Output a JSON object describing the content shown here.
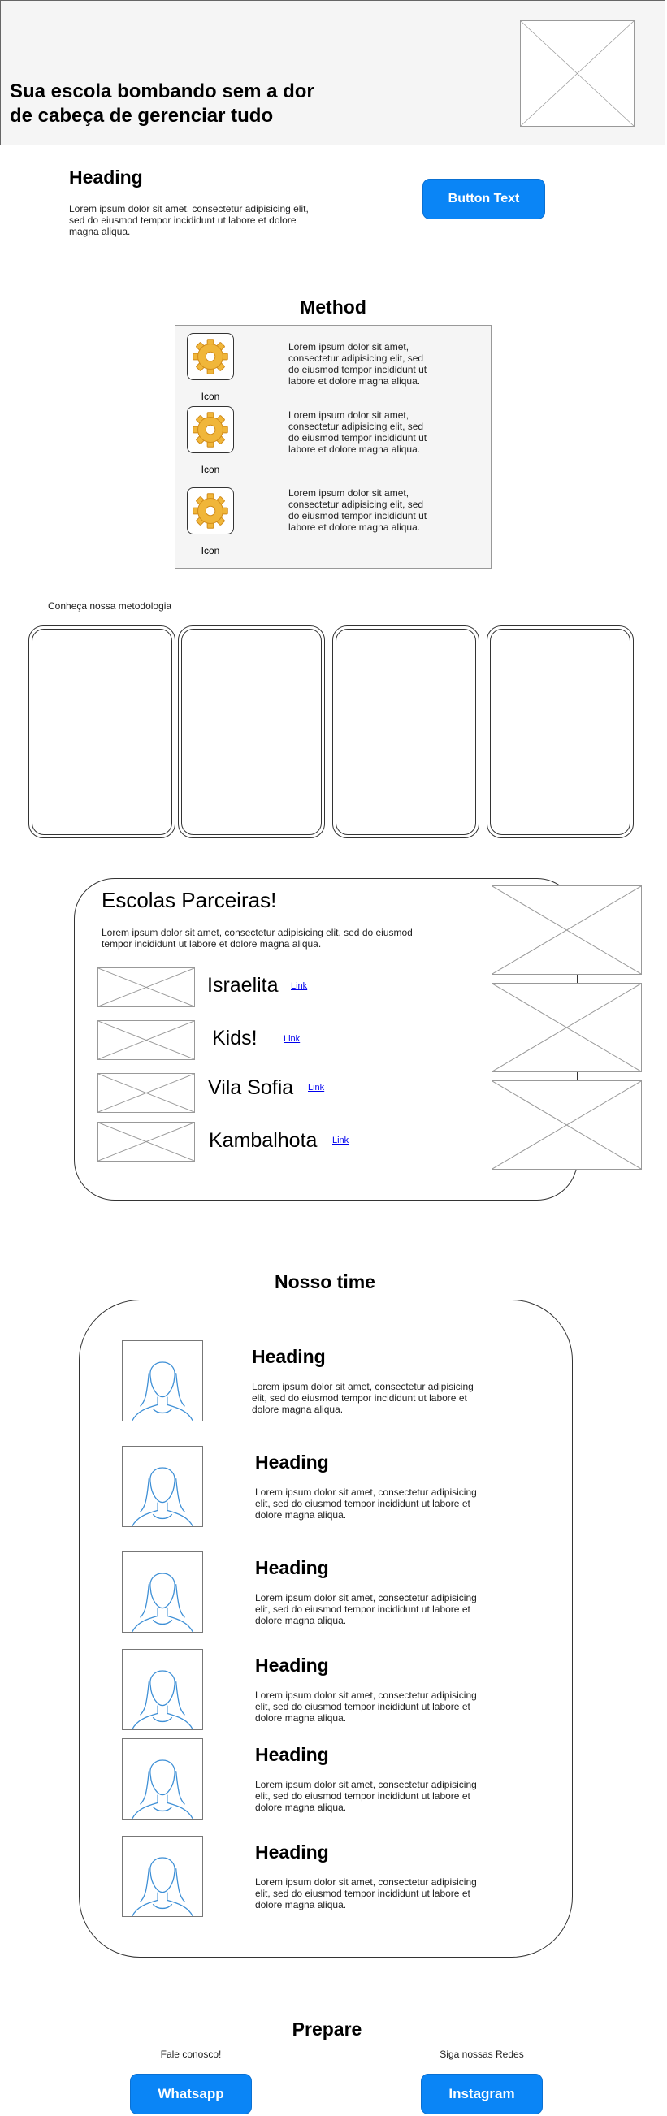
{
  "hero": {
    "title": "Sua escola bombando sem a dor\n de cabeça de gerenciar tudo"
  },
  "intro": {
    "heading": "Heading",
    "text": "Lorem ipsum dolor sit amet, consectetur adipisicing elit, sed do eiusmod tempor incididunt ut labore et dolore magna aliqua.",
    "button_label": "Button Text"
  },
  "method": {
    "title": "Method",
    "items": [
      {
        "icon_label": "Icon",
        "text": "Lorem ipsum dolor sit amet, consectetur adipisicing elit, sed do eiusmod tempor incididunt ut labore et dolore magna aliqua."
      },
      {
        "icon_label": "Icon",
        "text": "Lorem ipsum dolor sit amet, consectetur adipisicing elit, sed do eiusmod tempor incididunt ut labore et dolore magna aliqua."
      },
      {
        "icon_label": "Icon",
        "text": "Lorem ipsum dolor sit amet, consectetur adipisicing elit, sed do eiusmod tempor incididunt ut labore et dolore magna aliqua."
      }
    ],
    "cards_caption": "Conheça nossa metodologia"
  },
  "partners": {
    "title": "Escolas Parceiras!",
    "text": "Lorem ipsum dolor sit amet, consectetur adipisicing elit, sed do eiusmod tempor incididunt ut labore et dolore magna aliqua.",
    "schools": [
      {
        "name": "Israelita",
        "link": "Link"
      },
      {
        "name": "Kids!",
        "link": "Link"
      },
      {
        "name": "Vila Sofia",
        "link": "Link"
      },
      {
        "name": "Kambalhota",
        "link": "Link"
      }
    ]
  },
  "team": {
    "title": "Nosso time",
    "members": [
      {
        "heading": "Heading",
        "text": "Lorem ipsum dolor sit amet, consectetur adipisicing elit, sed do eiusmod tempor incididunt ut labore et dolore magna aliqua."
      },
      {
        "heading": "Heading",
        "text": "Lorem ipsum dolor sit amet, consectetur adipisicing elit, sed do eiusmod tempor incididunt ut labore et dolore magna aliqua."
      },
      {
        "heading": "Heading",
        "text": "Lorem ipsum dolor sit amet, consectetur adipisicing elit, sed do eiusmod tempor incididunt ut labore et dolore magna aliqua."
      },
      {
        "heading": "Heading",
        "text": "Lorem ipsum dolor sit amet, consectetur adipisicing elit, sed do eiusmod tempor incididunt ut labore et dolore magna aliqua."
      },
      {
        "heading": "Heading",
        "text": "Lorem ipsum dolor sit amet, consectetur adipisicing elit, sed do eiusmod tempor incididunt ut labore et dolore magna aliqua."
      },
      {
        "heading": "Heading",
        "text": "Lorem ipsum dolor sit amet, consectetur adipisicing elit, sed do eiusmod tempor incididunt ut labore et dolore magna aliqua."
      }
    ]
  },
  "prepare": {
    "title": "Prepare",
    "contact_caption": "Fale conosco!",
    "social_caption": "Siga nossas Redes",
    "whatsapp_label": "Whatsapp",
    "instagram_label": "Instagram"
  },
  "colors": {
    "primary_button": "#0a85f6",
    "placeholder_gray": "#f5f5f5",
    "avatar_line": "#3d8fd6"
  },
  "icons": [
    "gear-icon",
    "image-placeholder-icon",
    "avatar-icon"
  ]
}
